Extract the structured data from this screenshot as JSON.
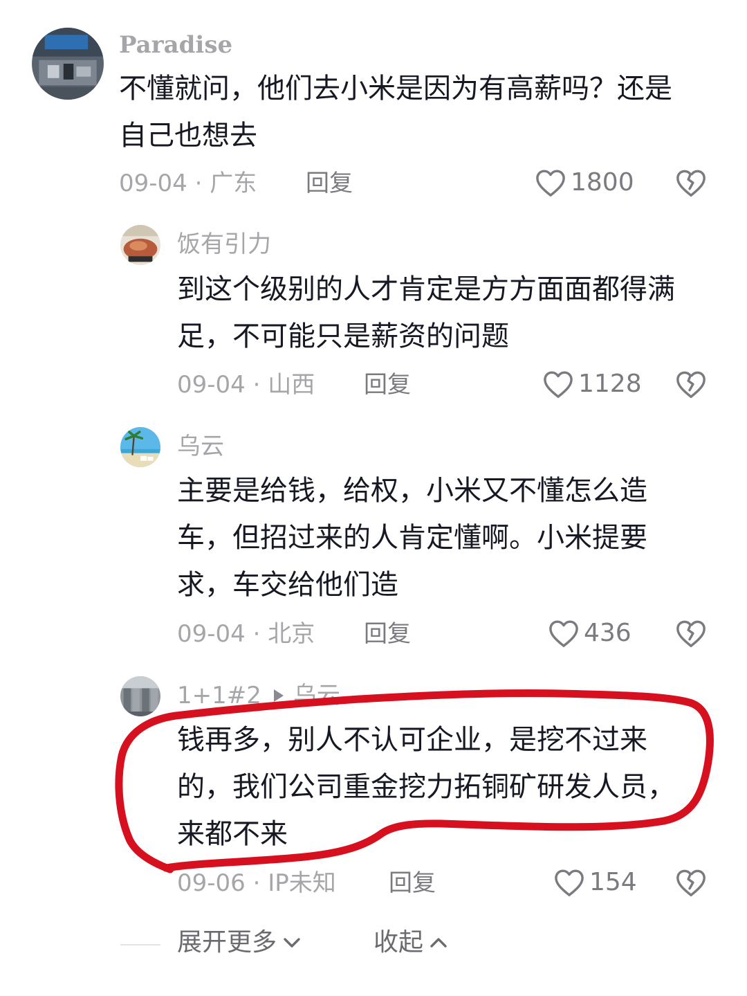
{
  "comments": [
    {
      "username": "Paradise",
      "text_lines": [
        "不懂就问，他们去小米是因为有高薪吗？还是",
        "自己也想去"
      ],
      "meta": "09-04 · 广东",
      "reply_label": "回复",
      "likes": "1800"
    },
    {
      "username": "饭有引力",
      "text_lines": [
        "到这个级别的人才肯定是方方面面都得满",
        "足，不可能只是薪资的问题"
      ],
      "meta": "09-04 · 山西",
      "reply_label": "回复",
      "likes": "1128"
    },
    {
      "username": "乌云",
      "text_lines": [
        "主要是给钱，给权，小米又不懂怎么造",
        "车，但招过来的人肯定懂啊。小米提要",
        "求，车交给他们造"
      ],
      "meta": "09-04 · 北京",
      "reply_label": "回复",
      "likes": "436"
    },
    {
      "username": "1+1#2",
      "reply_to": "乌云",
      "text_lines": [
        "钱再多，别人不认可企业，是挖不过来",
        "的，我们公司重金挖力拓铜矿研发人员，",
        "来都不来"
      ],
      "meta": "09-06 · IP未知",
      "reply_label": "回复",
      "likes": "154"
    }
  ],
  "footer": {
    "expand_label": "展开更多",
    "collapse_label": "收起"
  },
  "colors": {
    "highlight": "#d6101f",
    "text": "#161823",
    "muted": "#a6a6aa"
  }
}
